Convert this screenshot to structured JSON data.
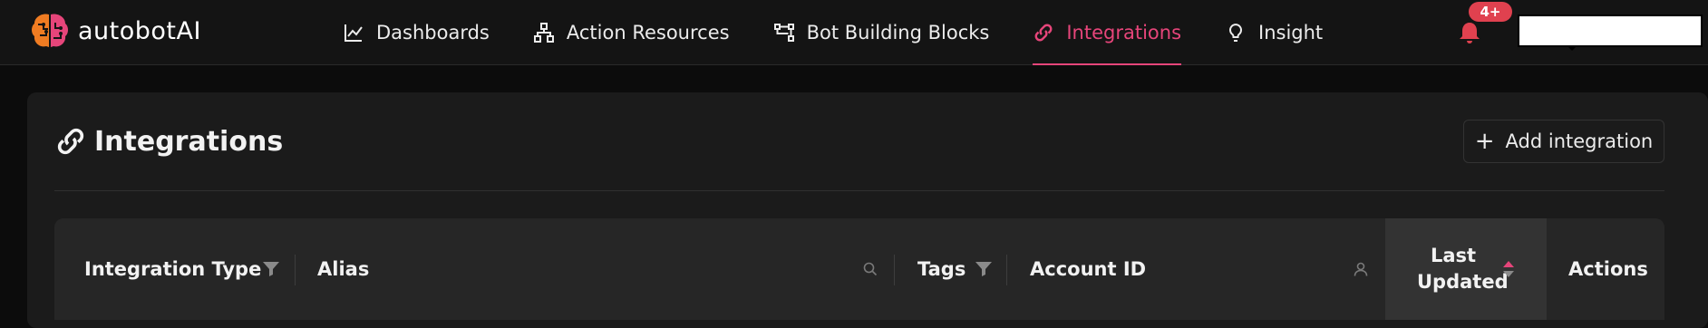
{
  "brand": {
    "name": "autobotAI",
    "colors": {
      "accent": "#e6457a",
      "logo_orange": "#f07c22",
      "logo_pink": "#e6457a"
    }
  },
  "nav": {
    "items": [
      {
        "label": "Dashboards",
        "icon": "line-chart-icon",
        "active": false
      },
      {
        "label": "Action Resources",
        "icon": "sitemap-icon",
        "active": false
      },
      {
        "label": "Bot Building Blocks",
        "icon": "nodes-icon",
        "active": false
      },
      {
        "label": "Integrations",
        "icon": "link-icon",
        "active": true
      },
      {
        "label": "Insight",
        "icon": "lightbulb-icon",
        "active": false
      }
    ]
  },
  "notifications": {
    "icon": "bell-icon",
    "badge": "4+"
  },
  "page": {
    "title": "Integrations",
    "title_icon": "link-icon",
    "add_button_label": "Add integration",
    "add_button_icon": "plus-icon"
  },
  "table": {
    "columns": [
      {
        "label": "Integration Type",
        "control": "filter-icon"
      },
      {
        "label": "Alias",
        "control": "search-icon"
      },
      {
        "label": "Tags",
        "control": "filter-icon"
      },
      {
        "label": "Account ID",
        "control": "user-icon"
      },
      {
        "label": "Last Updated",
        "control": "sort-icon",
        "sorted": true
      },
      {
        "label": "Actions",
        "control": null
      }
    ]
  }
}
